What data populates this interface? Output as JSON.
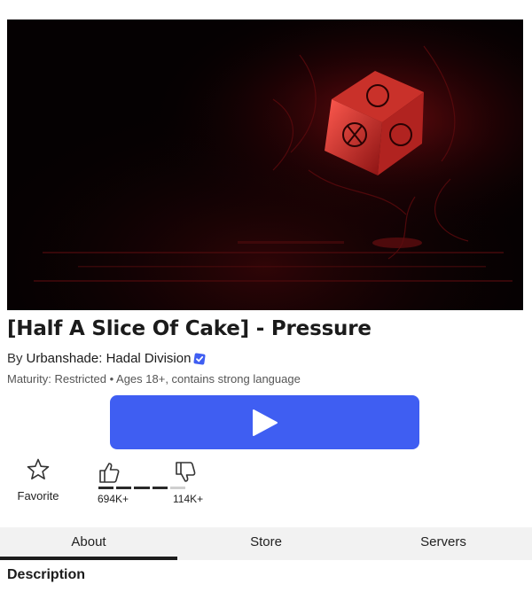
{
  "game": {
    "title": "[Half A Slice Of Cake] - Pressure",
    "by_label": "By",
    "creator": "Urbanshade: Hadal Division",
    "maturity": "Maturity: Restricted • Ages 18+, contains strong language",
    "thumbnail_icon": "glowing-red-cube-image"
  },
  "play_button": {
    "icon": "play-icon",
    "color": "#3f5ef2"
  },
  "actions": {
    "favorite_label": "Favorite",
    "upvotes": "694K+",
    "downvotes": "114K+",
    "like_ratio": 0.86
  },
  "tabs": [
    {
      "label": "About",
      "active": true
    },
    {
      "label": "Store",
      "active": false
    },
    {
      "label": "Servers",
      "active": false
    }
  ],
  "sections": {
    "description_heading": "Description"
  }
}
